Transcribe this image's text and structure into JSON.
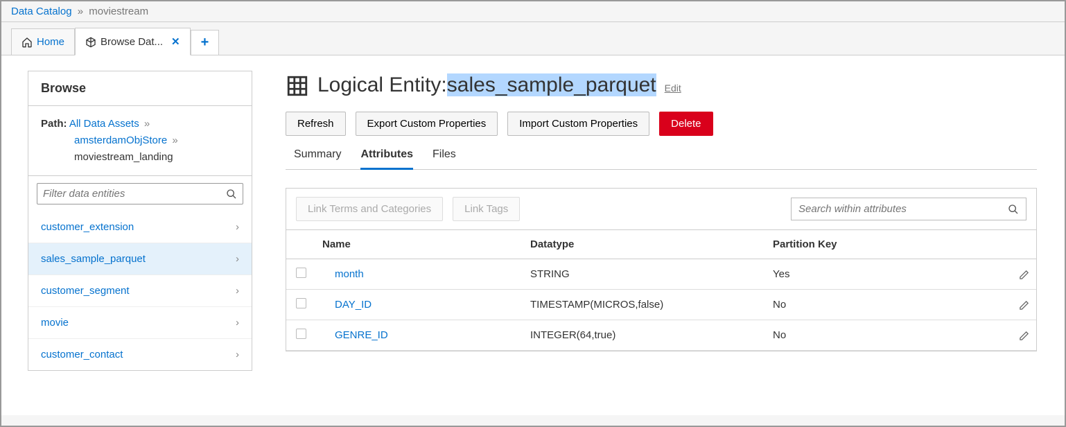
{
  "breadcrumb": {
    "root": "Data Catalog",
    "current": "moviestream"
  },
  "topTabs": {
    "home": "Home",
    "browse": "Browse Dat..."
  },
  "sidebar": {
    "title": "Browse",
    "pathLabel": "Path:",
    "path": {
      "root": "All Data Assets",
      "mid": "amsterdamObjStore",
      "leaf": "moviestream_landing"
    },
    "filterPlaceholder": "Filter data entities",
    "entities": [
      {
        "label": "customer_extension",
        "selected": false
      },
      {
        "label": "sales_sample_parquet",
        "selected": true
      },
      {
        "label": "customer_segment",
        "selected": false
      },
      {
        "label": "movie",
        "selected": false
      },
      {
        "label": "customer_contact",
        "selected": false
      }
    ]
  },
  "entity": {
    "prefix": "Logical Entity:",
    "name": "sales_sample_parquet",
    "editLabel": "Edit"
  },
  "actions": {
    "refresh": "Refresh",
    "export": "Export Custom Properties",
    "import": "Import Custom Properties",
    "delete": "Delete"
  },
  "subTabs": {
    "summary": "Summary",
    "attributes": "Attributes",
    "files": "Files"
  },
  "attrToolbar": {
    "linkTerms": "Link Terms and Categories",
    "linkTags": "Link Tags",
    "searchPlaceholder": "Search within attributes"
  },
  "table": {
    "headers": {
      "name": "Name",
      "datatype": "Datatype",
      "pk": "Partition Key"
    },
    "rows": [
      {
        "name": "month",
        "datatype": "STRING",
        "pk": "Yes"
      },
      {
        "name": "DAY_ID",
        "datatype": "TIMESTAMP(MICROS,false)",
        "pk": "No"
      },
      {
        "name": "GENRE_ID",
        "datatype": "INTEGER(64,true)",
        "pk": "No"
      }
    ]
  }
}
